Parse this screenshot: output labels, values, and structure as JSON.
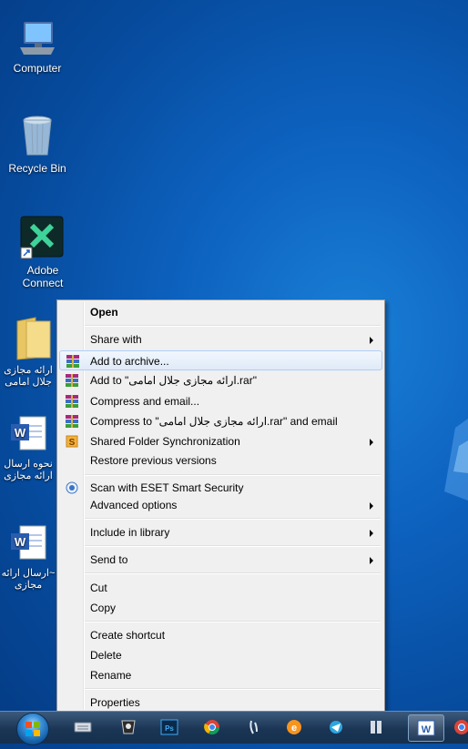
{
  "desktop": {
    "icons": [
      {
        "name": "computer",
        "label": "Computer"
      },
      {
        "name": "recycle-bin",
        "label": "Recycle Bin"
      },
      {
        "name": "adobe-connect",
        "label": "Adobe Connect"
      },
      {
        "name": "folder",
        "label": "ارائه مجازی جلال امامی"
      },
      {
        "name": "word-doc-1",
        "label": "نحوه ارسال ارائه مجازی"
      },
      {
        "name": "word-doc-2",
        "label": "~ارسال ارائه مجازی"
      }
    ]
  },
  "context_menu": {
    "items": [
      {
        "label": "Open",
        "bold": true
      },
      {
        "label": "Share with",
        "submenu": true
      },
      {
        "label": "Add to archive...",
        "icon": "winrar-icon",
        "hover": true
      },
      {
        "label": "Add to \"ارائه مجازی جلال امامی.rar\"",
        "icon": "winrar-icon"
      },
      {
        "label": "Compress and email...",
        "icon": "winrar-icon"
      },
      {
        "label": "Compress to \"ارائه مجازی جلال امامی.rar\" and email",
        "icon": "winrar-icon"
      },
      {
        "label": "Shared Folder Synchronization",
        "icon": "sync-icon",
        "submenu": true
      },
      {
        "label": "Restore previous versions"
      },
      {
        "label": "Scan with ESET Smart Security",
        "icon": "eset-icon"
      },
      {
        "label": "Advanced options",
        "submenu": true
      },
      {
        "label": "Include in library",
        "submenu": true
      },
      {
        "label": "Send to",
        "submenu": true
      },
      {
        "label": "Cut"
      },
      {
        "label": "Copy"
      },
      {
        "label": "Create shortcut"
      },
      {
        "label": "Delete"
      },
      {
        "label": "Rename"
      },
      {
        "label": "Properties"
      }
    ]
  },
  "taskbar": {
    "items": [
      "start-button",
      "keyboard-icon",
      "app-icon",
      "photoshop-icon",
      "chrome-icon",
      "tool-icon",
      "browser-icon",
      "telegram-icon",
      "winrar-icon",
      "word-icon",
      "chrome-icon-2"
    ],
    "word_label": "W",
    "photoshop_label": "Ps"
  },
  "colors": {
    "desktop": "#0d62bf",
    "menu_bg": "#f0f0f0",
    "hover_border": "#aecff7"
  }
}
